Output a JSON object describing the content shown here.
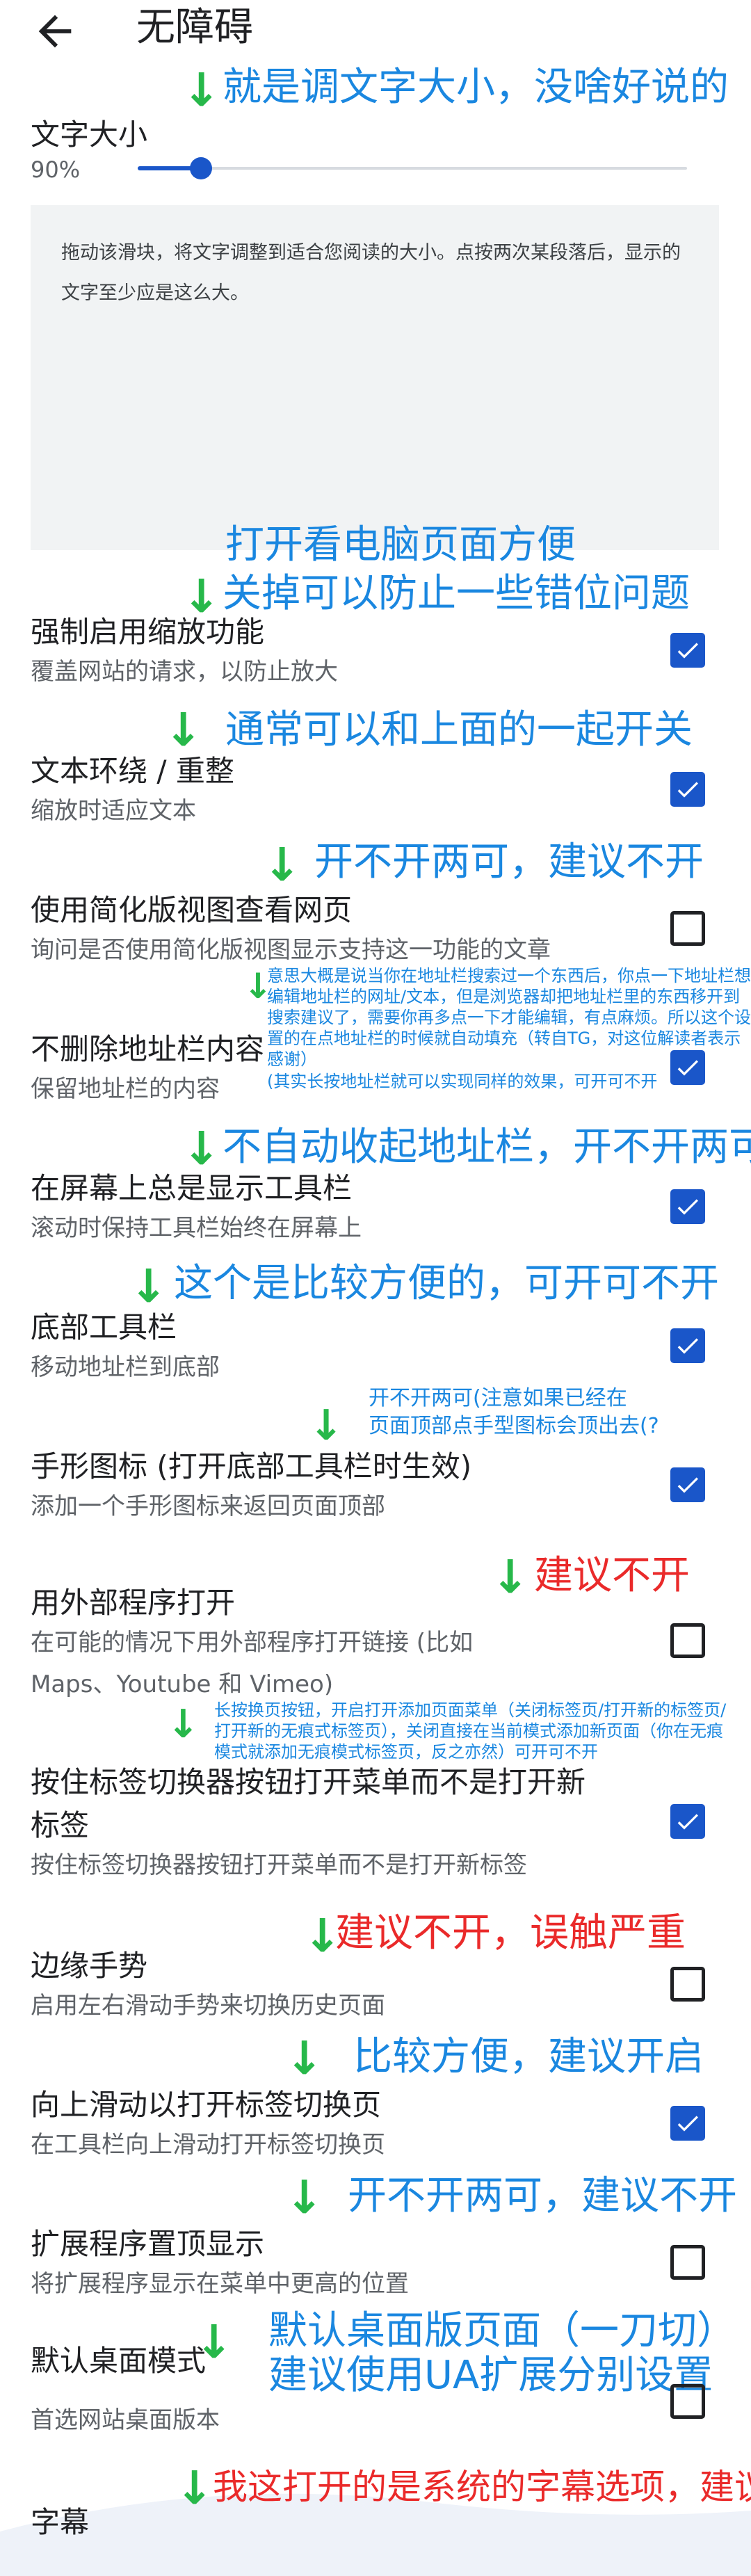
{
  "header": {
    "title": "无障碍"
  },
  "text_size": {
    "label": "文字大小",
    "value": "90%",
    "slider_fraction": 0.115,
    "preview": "拖动该滑块，将文字调整到适合您阅读的大小。点按两次某段落后，显示的文字至少应是这么大。"
  },
  "settings": [
    {
      "title": "强制启用缩放功能",
      "subtitle": "覆盖网站的请求，以防止放大",
      "checked": true
    },
    {
      "title": "文本环绕 / 重整",
      "subtitle": "缩放时适应文本",
      "checked": true
    },
    {
      "title": "使用简化版视图查看网页",
      "subtitle": "询问是否使用简化版视图显示支持这一功能的文章",
      "checked": false
    },
    {
      "title": "不删除地址栏内容",
      "subtitle": "保留地址栏的内容",
      "checked": true
    },
    {
      "title": "在屏幕上总是显示工具栏",
      "subtitle": "滚动时保持工具栏始终在屏幕上",
      "checked": true
    },
    {
      "title": "底部工具栏",
      "subtitle": "移动地址栏到底部",
      "checked": true
    },
    {
      "title": "手形图标 (打开底部工具栏时生效)",
      "subtitle": "添加一个手形图标来返回页面顶部",
      "checked": true
    },
    {
      "title": "用外部程序打开",
      "subtitle_line1": "在可能的情况下用外部程序打开链接 (比如",
      "subtitle_line2": "Maps、Youtube 和 Vimeo)",
      "checked": false
    },
    {
      "title_line1": "按住标签切换器按钮打开菜单而不是打开新",
      "title_line2": "标签",
      "subtitle": "按住标签切换器按钮打开菜单而不是打开新标签",
      "checked": true
    },
    {
      "title": "边缘手势",
      "subtitle": "启用左右滑动手势来切换历史页面",
      "checked": false
    },
    {
      "title": "向上滑动以打开标签切换页",
      "subtitle": "在工具栏向上滑动打开标签切换页",
      "checked": true
    },
    {
      "title": "扩展程序置顶显示",
      "subtitle": "将扩展程序显示在菜单中更高的位置",
      "checked": false
    },
    {
      "title": "默认桌面模式",
      "subtitle": "首选网站桌面版本",
      "checked": false
    },
    {
      "title": "字幕"
    }
  ],
  "annotations": {
    "a1": "就是调文字大小，没啥好说的",
    "a2a": "打开看电脑页面方便",
    "a2b": "关掉可以防止一些错位问题",
    "a3": "通常可以和上面的一起开关",
    "a4": "开不开两可，建议不开",
    "a5": "意思大概是说当你在地址栏搜索过一个东西后，你点一下地址栏想编辑地址栏的网址/文本，但是浏览器却把地址栏里的东西移开到搜索建议了，需要你再多点一下才能编辑，有点麻烦。所以这个设置的在点地址栏的时候就自动填充（转自TG，对这位解读者表示感谢）",
    "a5b": "(其实长按地址栏就可以实现同样的效果，可开可不开",
    "a6": "不自动收起地址栏，开不开两可",
    "a7": "这个是比较方便的，可开可不开",
    "a8a": "开不开两可(注意如果已经在",
    "a8b": "页面顶部点手型图标会顶出去(?",
    "a9": "建议不开",
    "a10": "长按换页按钮，开启打开添加页面菜单（关闭标签页/打开新的标签页/打开新的无痕式标签页），关闭直接在当前模式添加新页面（你在无痕模式就添加无痕模式标签页，反之亦然）可开可不开",
    "a11": "建议不开，误触严重",
    "a12": "比较方便，建议开启",
    "a13": "开不开两可，建议不开",
    "a14a": "默认桌面版页面（一刀切）",
    "a14b": "建议使用UA扩展分别设置",
    "a15": "我这打开的是系统的字幕选项，建议"
  },
  "colors": {
    "accent": "#1a56c9",
    "annotation_blue": "#1a87e0",
    "annotation_red": "#ea2a2a",
    "arrow_green": "#27b84a"
  },
  "icons": {
    "back": "arrow-left-icon",
    "arrow_annotation": "down-arrow-icon"
  }
}
